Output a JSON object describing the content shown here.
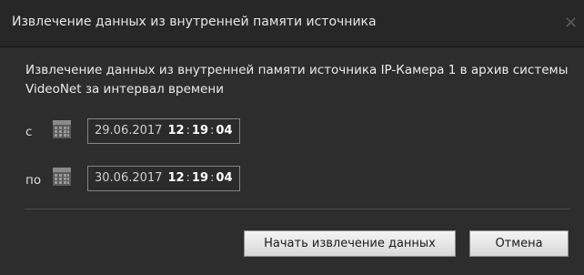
{
  "dialog": {
    "title": "Извлечение данных из внутренней памяти источника",
    "close_glyph": "×",
    "description": "Извлечение данных из внутренней памяти источника IP-Камера 1 в архив системы VideoNet за интервал времени"
  },
  "range": {
    "from": {
      "label": "с",
      "date": "29.06.2017",
      "hh": "12",
      "mm": "19",
      "ss": "04"
    },
    "to": {
      "label": "по",
      "date": "30.06.2017",
      "hh": "12",
      "mm": "19",
      "ss": "04"
    }
  },
  "buttons": {
    "start": "Начать извлечение данных",
    "cancel": "Отмена"
  },
  "icons": {
    "calendar": "calendar-icon",
    "close": "close-icon"
  }
}
